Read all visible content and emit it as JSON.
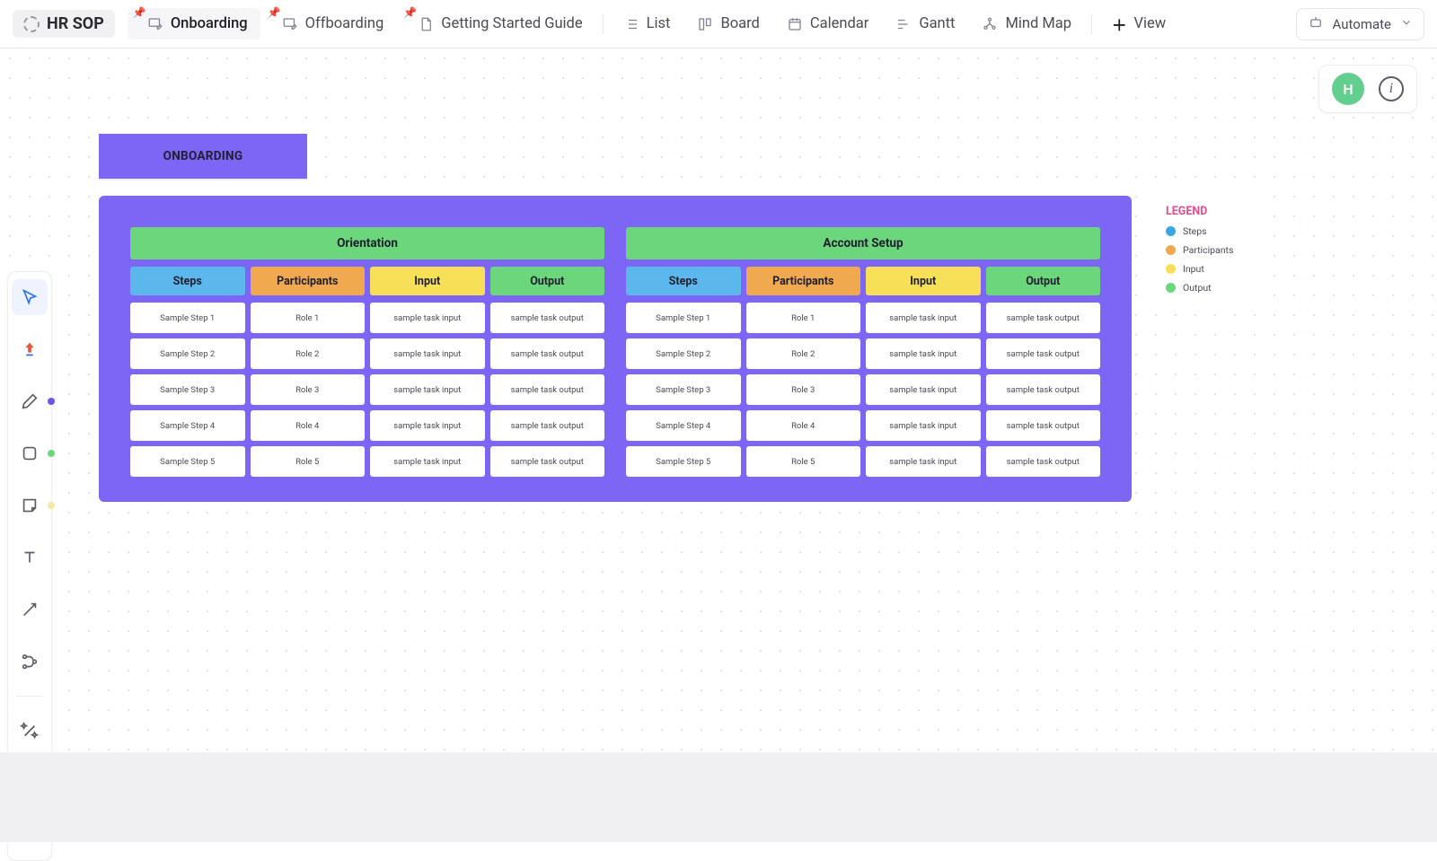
{
  "project": {
    "title": "HR SOP"
  },
  "tabs": {
    "pinned": [
      "Onboarding",
      "Offboarding",
      "Getting Started Guide"
    ],
    "views": [
      "List",
      "Board",
      "Calendar",
      "Gantt",
      "Mind Map"
    ],
    "add_view": "View",
    "active_index_pinned": 0
  },
  "automate": {
    "label": "Automate"
  },
  "avatar": {
    "initial": "H"
  },
  "onboarding_label": "ONBOARDING",
  "sections": [
    {
      "title": "Orientation",
      "columns": [
        "Steps",
        "Participants",
        "Input",
        "Output"
      ],
      "rows": [
        [
          "Sample Step 1",
          "Role 1",
          "sample task input",
          "sample task output"
        ],
        [
          "Sample Step 2",
          "Role 2",
          "sample task input",
          "sample task output"
        ],
        [
          "Sample Step 3",
          "Role 3",
          "sample task input",
          "sample task output"
        ],
        [
          "Sample Step 4",
          "Role 4",
          "sample task input",
          "sample task output"
        ],
        [
          "Sample Step 5",
          "Role 5",
          "sample task input",
          "sample task output"
        ]
      ]
    },
    {
      "title": "Account Setup",
      "columns": [
        "Steps",
        "Participants",
        "Input",
        "Output"
      ],
      "rows": [
        [
          "Sample Step 1",
          "Role 1",
          "sample task input",
          "sample task output"
        ],
        [
          "Sample Step 2",
          "Role 2",
          "sample task input",
          "sample task output"
        ],
        [
          "Sample Step 3",
          "Role 3",
          "sample task input",
          "sample task output"
        ],
        [
          "Sample Step 4",
          "Role 4",
          "sample task input",
          "sample task output"
        ],
        [
          "Sample Step 5",
          "Role 5",
          "sample task input",
          "sample task output"
        ]
      ]
    }
  ],
  "legend": {
    "title": "LEGEND",
    "items": [
      "Steps",
      "Participants",
      "Input",
      "Output"
    ]
  },
  "tools": [
    {
      "name": "pointer",
      "dot": null,
      "active": true
    },
    {
      "name": "upgrade",
      "dot": null,
      "active": false
    },
    {
      "name": "pen",
      "dot": "#6b57e8",
      "active": false
    },
    {
      "name": "shape",
      "dot": "#6bd67b",
      "active": false
    },
    {
      "name": "sticky",
      "dot": "#f4e7a7",
      "active": false
    },
    {
      "name": "text",
      "dot": null,
      "active": false
    },
    {
      "name": "connector",
      "dot": null,
      "active": false
    },
    {
      "name": "flow",
      "dot": null,
      "active": false
    },
    {
      "name": "divider",
      "dot": null,
      "active": false
    },
    {
      "name": "magic",
      "dot": null,
      "active": false
    },
    {
      "name": "web",
      "dot": null,
      "active": false
    },
    {
      "name": "image",
      "dot": null,
      "active": false
    }
  ]
}
